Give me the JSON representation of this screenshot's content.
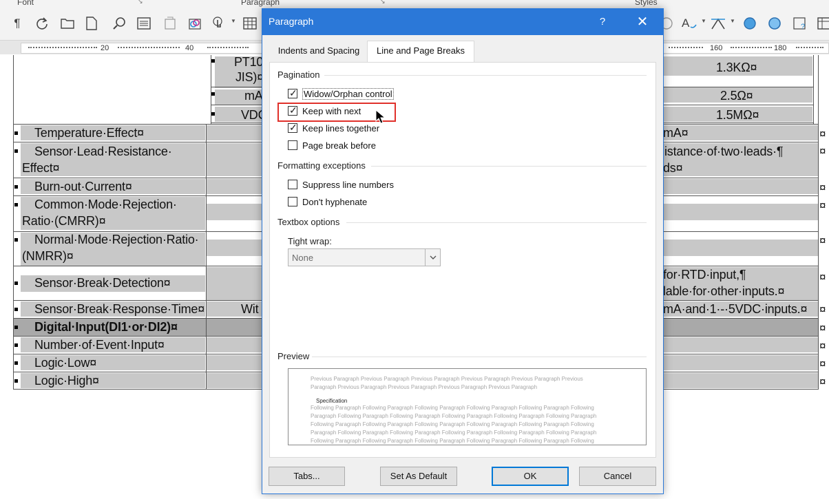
{
  "ribbon": {
    "groups": [
      {
        "label": "Font"
      },
      {
        "label": "Paragraph"
      },
      {
        "label": "Styles"
      }
    ]
  },
  "ruler": {
    "ticks": [
      "20",
      "40",
      "160",
      "180"
    ]
  },
  "document": {
    "partial_rows_right": [
      "1.3KΩ¤",
      "2.5Ω¤",
      "1.5MΩ¤"
    ],
    "partial_rows_left": [
      "PT10",
      "JIS)¤",
      "mA",
      "VDC"
    ],
    "rows": [
      {
        "label": "Temperature·Effect¤",
        "right": "mA¤"
      },
      {
        "label_1": "Sensor·Lead·Resistance·",
        "label_2": "Effect¤",
        "right_1": "istance·of·two·leads·¶",
        "right_2": "ds¤"
      },
      {
        "label": "Burn-out·Current¤"
      },
      {
        "label_1": "Common·Mode·Rejection·",
        "label_2": "Ratio·(CMRR)¤"
      },
      {
        "label_1": "Normal·Mode·Rejection·Ratio·",
        "label_2": "(NMRR)¤"
      },
      {
        "label": "Sensor·Break·Detection¤",
        "right_1": "for·RTD·input,¶",
        "right_2": "lable·for·other·inputs.¤"
      },
      {
        "label": "Sensor·Break·Response·Time¤",
        "mid": "Wit",
        "right": "mA·and·1·-·5VDC·inputs.¤"
      },
      {
        "label": "Digital·Input(DI1·or·DI2)¤"
      },
      {
        "label": "Number·of·Event·Input¤"
      },
      {
        "label": "Logic·Low¤"
      },
      {
        "label": "Logic·High¤"
      }
    ],
    "end_mark": "¤"
  },
  "dialog": {
    "title": "Paragraph",
    "help_label": "?",
    "close_label": "✕",
    "tabs": [
      {
        "label": "Indents and Spacing"
      },
      {
        "label": "Line and Page Breaks"
      }
    ],
    "pagination": {
      "label": "Pagination",
      "options": [
        {
          "label": "Widow/Orphan control",
          "checked": true
        },
        {
          "label": "Keep with next",
          "checked": true
        },
        {
          "label": "Keep lines together",
          "checked": true
        },
        {
          "label": "Page break before",
          "checked": false
        }
      ]
    },
    "formatting": {
      "label": "Formatting exceptions",
      "options": [
        {
          "label": "Suppress line numbers",
          "checked": false
        },
        {
          "label": "Don't hyphenate",
          "checked": false
        }
      ]
    },
    "textbox": {
      "label": "Textbox options",
      "tight_wrap_label": "Tight wrap:",
      "tight_wrap_value": "None"
    },
    "preview": {
      "label": "Preview",
      "previous_1": "Previous Paragraph Previous Paragraph Previous Paragraph Previous Paragraph Previous Paragraph Previous",
      "previous_2": "Paragraph Previous Paragraph Previous Paragraph Previous Paragraph Previous Paragraph",
      "current": "Specification",
      "following_1": "Following Paragraph Following Paragraph Following Paragraph Following Paragraph Following Paragraph Following",
      "following_2": "Paragraph Following Paragraph Following Paragraph Following Paragraph Following Paragraph Following Paragraph",
      "following_3": "Following Paragraph Following Paragraph Following Paragraph Following Paragraph Following Paragraph Following",
      "following_4": "Paragraph Following Paragraph Following Paragraph Following Paragraph Following Paragraph Following Paragraph",
      "following_5": "Following Paragraph Following Paragraph Following Paragraph Following Paragraph Following Paragraph Following",
      "following_6": "Paragraph Following Paragraph Following Paragraph Following Paragraph Following Paragraph Following Paragraph",
      "following_7": "Following Paragraph Following Paragraph Following Paragraph Following Paragraph Following Paragraph Following"
    },
    "buttons": {
      "tabs": "Tabs...",
      "set_default": "Set As Default",
      "ok": "OK",
      "cancel": "Cancel"
    }
  },
  "colors": {
    "titlebar": "#2b78d8",
    "highlight": "#e0302a",
    "table_shading": "#c8c8c8",
    "table_shading_dark": "#a9a9a9"
  }
}
